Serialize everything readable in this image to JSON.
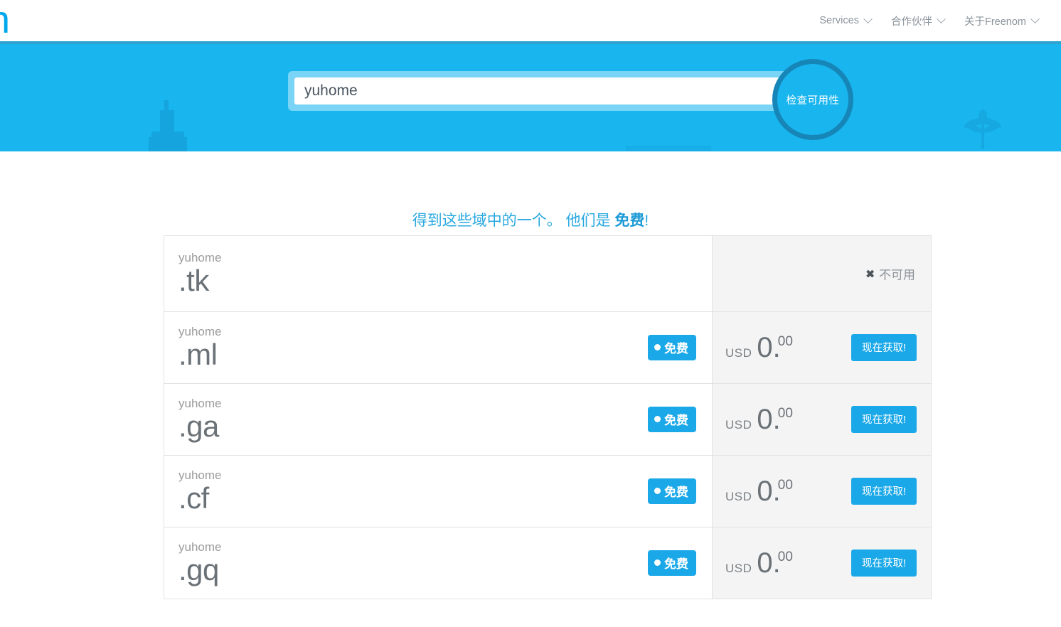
{
  "header": {
    "logo_glyph": "n",
    "nav": [
      {
        "label": "Services",
        "icon": "chevron-down-icon"
      },
      {
        "label": "合作伙伴",
        "icon": "chevron-down-icon"
      },
      {
        "label": "关于Freenom",
        "icon": "chevron-down-icon"
      }
    ]
  },
  "hero": {
    "search": {
      "value": "yuhome",
      "placeholder": "输入您想要的域名"
    },
    "check_button_label": "检查可用性",
    "background_color": "#19b5ef",
    "silhouettes": [
      "building-silhouette",
      "palm-tree-silhouette"
    ]
  },
  "headline": {
    "text_before": "得到这些域中的一个。 他们是 ",
    "emphasis": "免费",
    "text_after": "!",
    "color": "#29a8e0"
  },
  "results": {
    "free_badge_label": "免费",
    "get_button_label": "现在获取!",
    "unavailable_label": "不可用",
    "unavailable_icon": "cross-icon",
    "currency": "USD",
    "rows": [
      {
        "sld": "yuhome",
        "tld": ".tk",
        "available": false,
        "status": "不可用"
      },
      {
        "sld": "yuhome",
        "tld": ".ml",
        "available": true,
        "badge": "免费",
        "currency": "USD",
        "price_whole": "0",
        "price_cents": "00",
        "action": "现在获取!"
      },
      {
        "sld": "yuhome",
        "tld": ".ga",
        "available": true,
        "badge": "免费",
        "currency": "USD",
        "price_whole": "0",
        "price_cents": "00",
        "action": "现在获取!"
      },
      {
        "sld": "yuhome",
        "tld": ".cf",
        "available": true,
        "badge": "免费",
        "currency": "USD",
        "price_whole": "0",
        "price_cents": "00",
        "action": "现在获取!"
      },
      {
        "sld": "yuhome",
        "tld": ".gq",
        "available": true,
        "badge": "免费",
        "currency": "USD",
        "price_whole": "0",
        "price_cents": "00",
        "action": "现在获取!"
      }
    ]
  },
  "colors": {
    "brand_blue": "#19b5ef",
    "accent_blue": "#1aa8e8",
    "ring_blue": "#1686b8",
    "text_gray": "#6a7177",
    "panel_gray": "#f4f4f4"
  }
}
